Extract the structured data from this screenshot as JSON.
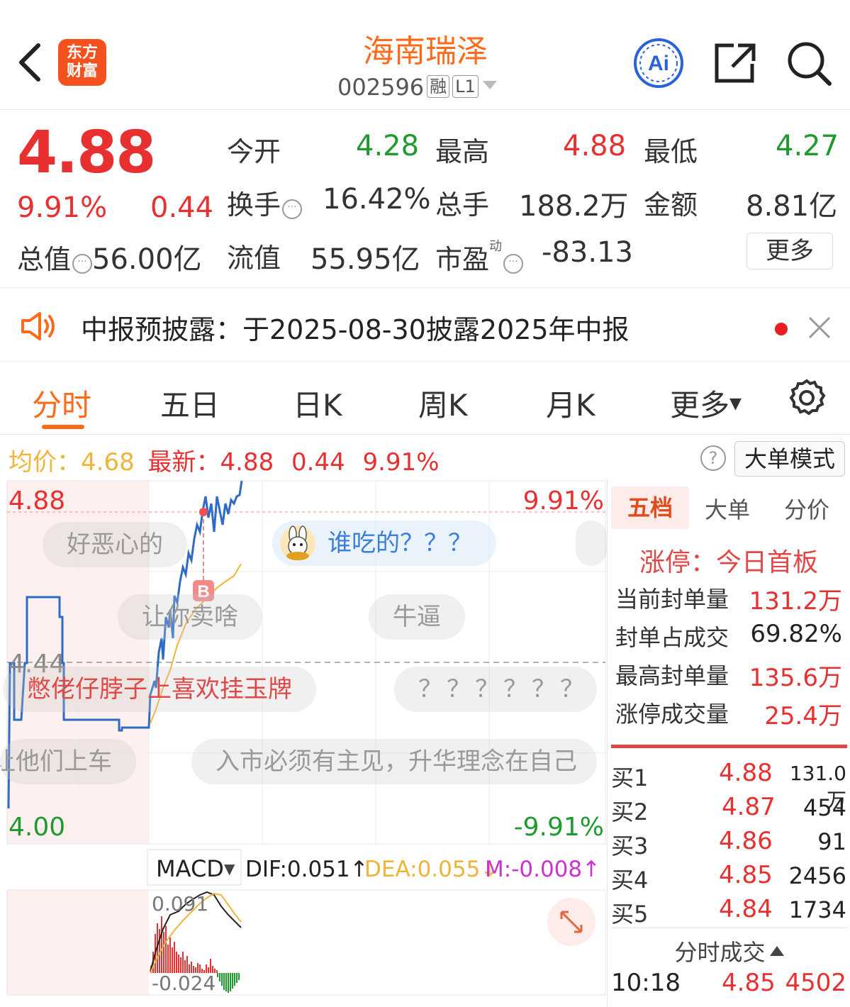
{
  "header": {
    "logo_line1": "东方",
    "logo_line2": "财富",
    "stock_name": "海南瑞泽",
    "stock_code": "002596",
    "badge_margin": "融",
    "badge_level": "L1"
  },
  "quote": {
    "price": "4.88",
    "change_pct": "9.91%",
    "change_amt": "0.44",
    "open_label": "今开",
    "open_value": "4.28",
    "high_label": "最高",
    "high_value": "4.88",
    "low_label": "最低",
    "low_value": "4.27",
    "turnover_label": "换手",
    "turnover_value": "16.42%",
    "volume_label": "总手",
    "volume_value": "188.2万",
    "amount_label": "金额",
    "amount_value": "8.81亿",
    "mktcap_label": "总值",
    "mktcap_value": "56.00亿",
    "float_label": "流值",
    "float_value": "55.95亿",
    "pe_label": "市盈",
    "pe_sup": "动",
    "pe_value": "-83.13",
    "more_label": "更多"
  },
  "notice": {
    "text": "中报预披露：于2025-08-30披露2025年中报"
  },
  "tabs": {
    "items": [
      "分时",
      "五日",
      "日K",
      "周K",
      "月K",
      "更多"
    ],
    "active": "分时"
  },
  "infobar": {
    "avg_label": "均价：",
    "avg_value": "4.68",
    "latest_label": "最新：",
    "latest_value": "4.88",
    "latest_change": "0.44",
    "latest_pct": "9.91%",
    "bigorder_label": "大单模式",
    "help_symbol": "?"
  },
  "chart": {
    "price_top": "4.88",
    "price_mid": "4.44",
    "price_bottom": "4.00",
    "pct_top": "9.91%",
    "pct_bottom": "-9.91%",
    "buy_marker": "B",
    "macd_label": "MACD",
    "dif": "DIF:0.051↑",
    "dea": "DEA:0.055↓",
    "m": "M:-0.008↑",
    "macd_top": "0.091",
    "macd_bottom": "-0.024",
    "colors": {
      "price_line": "#2f6bc4",
      "avg_line": "#f0b43a",
      "up": "#e93030",
      "down": "#1f9a2e",
      "macd_m": "#cc33cc"
    }
  },
  "danmaku": [
    "好恶心的",
    "谁吃的？？？",
    "让你卖啥",
    "牛逼",
    "憋佬仔脖子上喜欢挂玉牌",
    "？？？？？？",
    "让他们上车",
    "入市必须有主见，升华理念在自己"
  ],
  "right_panel": {
    "tabs": [
      "五档",
      "大单",
      "分价"
    ],
    "limit_title": "涨停：今日首板",
    "stats": [
      {
        "label": "当前封单量",
        "value": "131.2万"
      },
      {
        "label": "封单占成交",
        "value": "69.82%"
      },
      {
        "label": "最高封单量",
        "value": "135.6万"
      },
      {
        "label": "涨停成交量",
        "value": "25.4万"
      }
    ],
    "book": [
      {
        "label": "买1",
        "price": "4.88",
        "vol": "131.0万"
      },
      {
        "label": "买2",
        "price": "4.87",
        "vol": "454"
      },
      {
        "label": "买3",
        "price": "4.86",
        "vol": "91"
      },
      {
        "label": "买4",
        "price": "4.85",
        "vol": "2456"
      },
      {
        "label": "买5",
        "price": "4.84",
        "vol": "1734"
      }
    ],
    "trade_title": "分时成交",
    "trades": [
      {
        "time": "10:18",
        "price": "4.85",
        "vol": "4502"
      }
    ]
  }
}
